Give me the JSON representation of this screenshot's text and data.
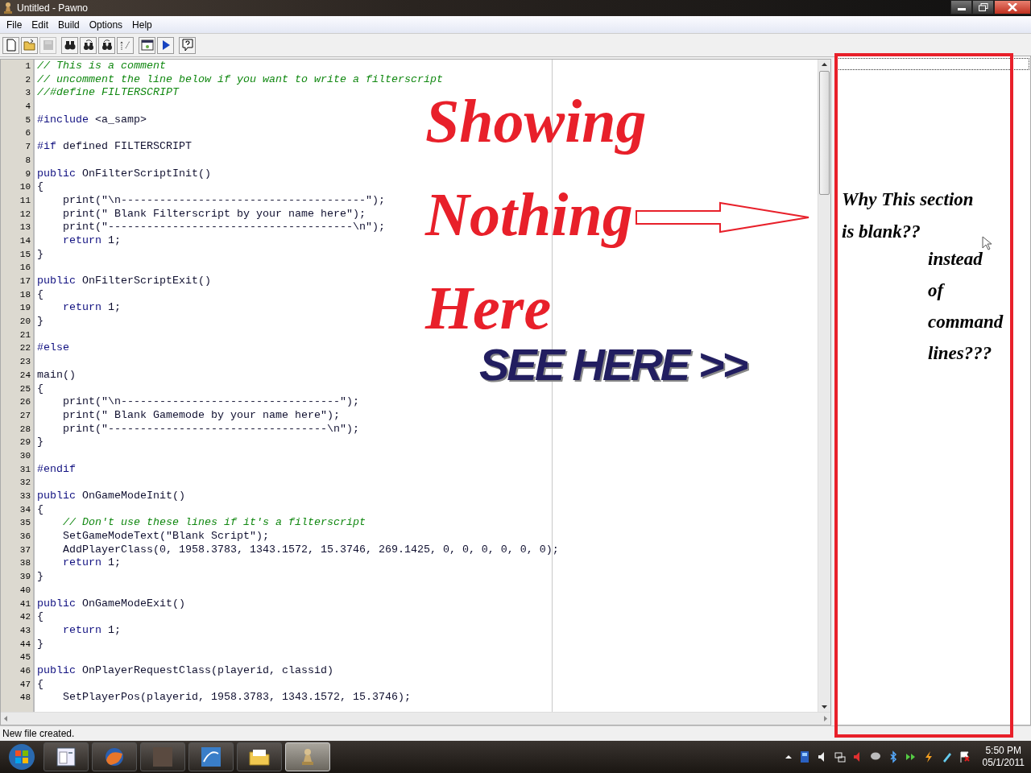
{
  "window": {
    "title": "Untitled - Pawno"
  },
  "menu": [
    {
      "label": "File"
    },
    {
      "label": "Edit"
    },
    {
      "label": "Build"
    },
    {
      "label": "Options"
    },
    {
      "label": "Help"
    }
  ],
  "toolbar": [
    {
      "kind": "new",
      "disabled": false
    },
    {
      "kind": "open",
      "disabled": false
    },
    {
      "kind": "save",
      "disabled": true
    },
    {
      "kind": "find",
      "disabled": false
    },
    {
      "kind": "find-next",
      "disabled": false
    },
    {
      "kind": "replace",
      "disabled": false
    },
    {
      "kind": "goto",
      "disabled": false
    },
    {
      "kind": "compile",
      "disabled": false
    },
    {
      "kind": "run",
      "disabled": false
    },
    {
      "kind": "help",
      "disabled": false
    }
  ],
  "editor": {
    "lines": [
      {
        "number": "1",
        "segments": [
          {
            "kind": "comment",
            "text": "// This is a comment"
          }
        ]
      },
      {
        "number": "2",
        "segments": [
          {
            "kind": "comment",
            "text": "// uncomment the line below if you want to write a filterscript"
          }
        ]
      },
      {
        "number": "3",
        "segments": [
          {
            "kind": "comment",
            "text": "//#define FILTERSCRIPT"
          }
        ]
      },
      {
        "number": "4"
      },
      {
        "number": "5",
        "segments": [
          {
            "kind": "keyword",
            "text": "#include"
          },
          {
            "kind": "plain",
            "text": " <a_samp>"
          }
        ]
      },
      {
        "number": "6"
      },
      {
        "number": "7",
        "segments": [
          {
            "kind": "keyword",
            "text": "#if"
          },
          {
            "kind": "plain",
            "text": " defined FILTERSCRIPT"
          }
        ]
      },
      {
        "number": "8"
      },
      {
        "number": "9",
        "segments": [
          {
            "kind": "keyword",
            "text": "public"
          },
          {
            "kind": "plain",
            "text": " OnFilterScriptInit()"
          }
        ]
      },
      {
        "number": "10",
        "segments": [
          {
            "kind": "plain",
            "text": "{"
          }
        ]
      },
      {
        "number": "11",
        "segments": [
          {
            "kind": "plain",
            "text": "    print(\"\\n--------------------------------------\");"
          }
        ]
      },
      {
        "number": "12",
        "segments": [
          {
            "kind": "plain",
            "text": "    print(\" Blank Filterscript by your name here\");"
          }
        ]
      },
      {
        "number": "13",
        "segments": [
          {
            "kind": "plain",
            "text": "    print(\"--------------------------------------\\n\");"
          }
        ]
      },
      {
        "number": "14",
        "indent": true,
        "segments": [
          {
            "kind": "keyword",
            "text": "return"
          },
          {
            "kind": "plain",
            "text": " 1;"
          }
        ]
      },
      {
        "number": "15",
        "segments": [
          {
            "kind": "plain",
            "text": "}"
          }
        ]
      },
      {
        "number": "16"
      },
      {
        "number": "17",
        "segments": [
          {
            "kind": "keyword",
            "text": "public"
          },
          {
            "kind": "plain",
            "text": " OnFilterScriptExit()"
          }
        ]
      },
      {
        "number": "18",
        "segments": [
          {
            "kind": "plain",
            "text": "{"
          }
        ]
      },
      {
        "number": "19",
        "indent": true,
        "segments": [
          {
            "kind": "keyword",
            "text": "return"
          },
          {
            "kind": "plain",
            "text": " 1;"
          }
        ]
      },
      {
        "number": "20",
        "segments": [
          {
            "kind": "plain",
            "text": "}"
          }
        ]
      },
      {
        "number": "21"
      },
      {
        "number": "22",
        "segments": [
          {
            "kind": "keyword",
            "text": "#else"
          }
        ]
      },
      {
        "number": "23"
      },
      {
        "number": "24",
        "segments": [
          {
            "kind": "plain",
            "text": "main()"
          }
        ]
      },
      {
        "number": "25",
        "segments": [
          {
            "kind": "plain",
            "text": "{"
          }
        ]
      },
      {
        "number": "26",
        "segments": [
          {
            "kind": "plain",
            "text": "    print(\"\\n----------------------------------\");"
          }
        ]
      },
      {
        "number": "27",
        "segments": [
          {
            "kind": "plain",
            "text": "    print(\" Blank Gamemode by your name here\");"
          }
        ]
      },
      {
        "number": "28",
        "segments": [
          {
            "kind": "plain",
            "text": "    print(\"----------------------------------\\n\");"
          }
        ]
      },
      {
        "number": "29",
        "segments": [
          {
            "kind": "plain",
            "text": "}"
          }
        ]
      },
      {
        "number": "30"
      },
      {
        "number": "31",
        "segments": [
          {
            "kind": "keyword",
            "text": "#endif"
          }
        ]
      },
      {
        "number": "32"
      },
      {
        "number": "33",
        "segments": [
          {
            "kind": "keyword",
            "text": "public"
          },
          {
            "kind": "plain",
            "text": " OnGameModeInit()"
          }
        ]
      },
      {
        "number": "34",
        "segments": [
          {
            "kind": "plain",
            "text": "{"
          }
        ]
      },
      {
        "number": "35",
        "indent": true,
        "segments": [
          {
            "kind": "comment",
            "text": "// Don't use these lines if it's a filterscript"
          }
        ]
      },
      {
        "number": "36",
        "segments": [
          {
            "kind": "plain",
            "text": "    SetGameModeText(\"Blank Script\");"
          }
        ]
      },
      {
        "number": "37",
        "segments": [
          {
            "kind": "plain",
            "text": "    AddPlayerClass(0, 1958.3783, 1343.1572, 15.3746, 269.1425, 0, 0, 0, 0, 0, 0);"
          }
        ]
      },
      {
        "number": "38",
        "indent": true,
        "segments": [
          {
            "kind": "keyword",
            "text": "return"
          },
          {
            "kind": "plain",
            "text": " 1;"
          }
        ]
      },
      {
        "number": "39",
        "segments": [
          {
            "kind": "plain",
            "text": "}"
          }
        ]
      },
      {
        "number": "40"
      },
      {
        "number": "41",
        "segments": [
          {
            "kind": "keyword",
            "text": "public"
          },
          {
            "kind": "plain",
            "text": " OnGameModeExit()"
          }
        ]
      },
      {
        "number": "42",
        "segments": [
          {
            "kind": "plain",
            "text": "{"
          }
        ]
      },
      {
        "number": "43",
        "indent": true,
        "segments": [
          {
            "kind": "keyword",
            "text": "return"
          },
          {
            "kind": "plain",
            "text": " 1;"
          }
        ]
      },
      {
        "number": "44",
        "segments": [
          {
            "kind": "plain",
            "text": "}"
          }
        ]
      },
      {
        "number": "45"
      },
      {
        "number": "46",
        "segments": [
          {
            "kind": "keyword",
            "text": "public"
          },
          {
            "kind": "plain",
            "text": " OnPlayerRequestClass(playerid, classid)"
          }
        ]
      },
      {
        "number": "47",
        "segments": [
          {
            "kind": "plain",
            "text": "{"
          }
        ]
      },
      {
        "number": "48",
        "segments": [
          {
            "kind": "plain",
            "text": "    SetPlayerPos(playerid, 1958.3783, 1343.1572, 15.3746);"
          }
        ]
      }
    ]
  },
  "status_bar": {
    "message": "New file created."
  },
  "annotations": {
    "headline": [
      "Showing",
      "Nothing",
      "Here"
    ],
    "pointer": "SEE HERE >>",
    "question": [
      "Why This section",
      "is blank??"
    ],
    "followup": [
      "instead",
      "of",
      "command",
      "lines???"
    ]
  },
  "taskbar": {
    "apps": [
      {
        "kind": "document",
        "selected": false
      },
      {
        "kind": "browser",
        "selected": false
      },
      {
        "kind": "photo",
        "selected": false
      },
      {
        "kind": "swirl",
        "selected": false
      },
      {
        "kind": "folder",
        "selected": false
      },
      {
        "kind": "pawn",
        "selected": true
      }
    ],
    "clock": {
      "time": "5:50 PM",
      "date": "05/1/2011"
    }
  }
}
